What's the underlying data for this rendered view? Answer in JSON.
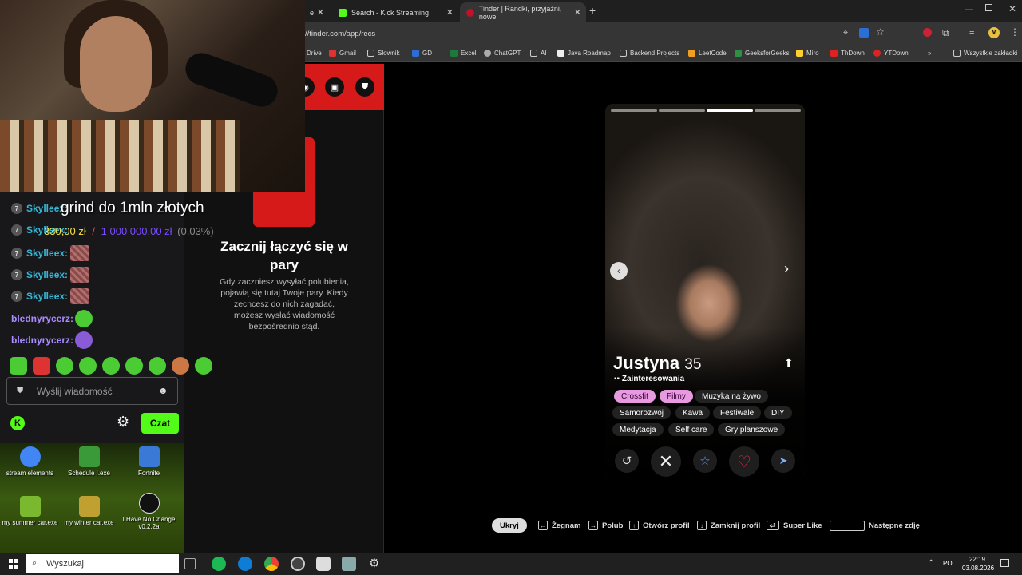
{
  "browser": {
    "tabs": [
      {
        "label": "Search - Kick Streaming",
        "color": "#53fc18"
      },
      {
        "label": "Tinder | Randki, przyjaźni, nowe",
        "color": "#fe3c72"
      }
    ],
    "url": "//tinder.com/app/recs",
    "bookmarks": [
      "Drive",
      "Gmail",
      "Słownik",
      "GD",
      "Excel",
      "ChatGPT",
      "AI",
      "Java Roadmap",
      "Backend Projects",
      "LeetCode",
      "GeeksforGeeks",
      "Miro",
      "ThDown",
      "YTDown",
      "Wszystkie zakładki"
    ]
  },
  "stream": {
    "goal_title": "grind do 1mln złotych",
    "goal_current": "330,00 zł",
    "goal_sep": "/",
    "goal_target": "1 000 000,00 zł",
    "goal_pct": "(0.03%)",
    "chat": [
      {
        "badge": "7",
        "user": "Skylleex:"
      },
      {
        "badge": "7",
        "user": "Skylleex:"
      },
      {
        "badge": "7",
        "user": "Skylleex:"
      },
      {
        "badge": "7",
        "user": "Skylleex:"
      },
      {
        "badge": "7",
        "user": "Skylleex:"
      },
      {
        "badge": "",
        "user": "blednyrycerz:"
      },
      {
        "badge": "",
        "user": "blednyrycerz:"
      }
    ],
    "input_placeholder": "Wyślij wiadomość",
    "send_label": "Czat"
  },
  "tinder": {
    "empty_title": "Zacznij łączyć się w pary",
    "empty_desc": "Gdy zaczniesz wysyłać polubienia, pojawią się tutaj Twoje pary. Kiedy zechcesz do nich zagadać, możesz wysłać wiadomość bezpośrednio stąd.",
    "profile": {
      "name": "Justyna",
      "age": "35",
      "section": "Zainteresowania",
      "interests": [
        "Crossfit",
        "Filmy",
        "Muzyka na żywo",
        "Samorozwój",
        "Kawa",
        "Festiwale",
        "DIY",
        "Medytacja",
        "Self care",
        "Gry planszowe"
      ]
    },
    "shortcuts": {
      "hide": "Ukryj",
      "nope": "Żegnam",
      "like": "Polub",
      "open": "Otwórz profil",
      "close": "Zamknij profil",
      "super": "Super Like",
      "next": "Następne zdję"
    }
  },
  "desktop": {
    "icons": [
      "stream elements",
      "Schedule I.exe",
      "Fortnite",
      "my summer car.exe",
      "my winter car.exe",
      "I Have No Change v0.2.2a"
    ]
  },
  "taskbar": {
    "search": "Wyszukaj",
    "lang": "POL",
    "time": "22:19",
    "date": "03.08.2026"
  }
}
